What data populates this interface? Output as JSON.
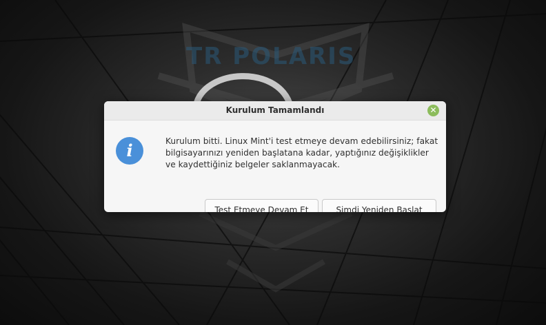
{
  "dialog": {
    "title": "Kurulum Tamamlandı",
    "close_glyph": "✕",
    "icon": "info-icon",
    "icon_glyph": "i",
    "message": "Kurulum bitti. Linux Mint'i test etmeye devam edebilirsiniz; fakat bilgisayarınızı yeniden başlatana kadar, yaptığınız değişiklikler ve kaydettiğiniz belgeler saklanmayacak.",
    "buttons": {
      "continue_label": "Test Etmeye Devam Et",
      "restart_label": "Şimdi Yeniden Başlat"
    }
  },
  "background": {
    "watermark_text": "TR POLARIS"
  },
  "colors": {
    "accent_close": "#8cbc5c",
    "info_icon": "#4a90d9",
    "dialog_bg": "#f6f6f6"
  }
}
